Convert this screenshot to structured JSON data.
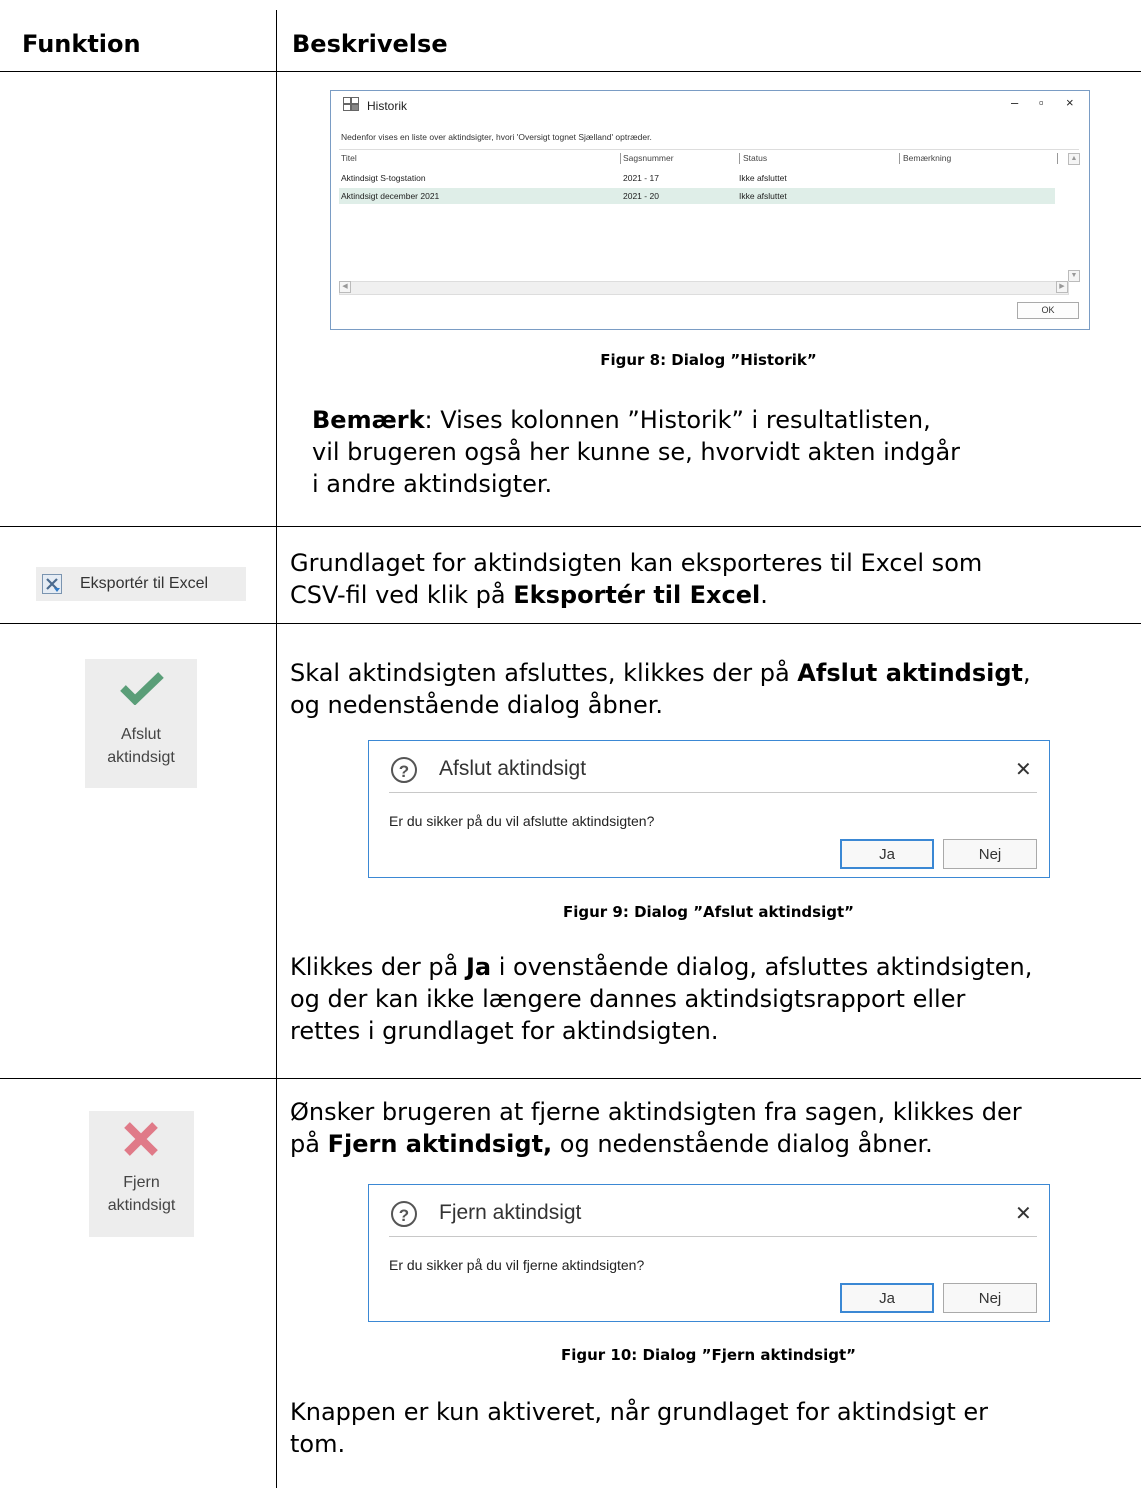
{
  "table": {
    "col_function": "Funktion",
    "col_description": "Beskrivelse"
  },
  "historik": {
    "title": "Historik",
    "description": "Nedenfor vises en liste over aktindsigter, hvori 'Oversigt tognet Sjælland' optræder.",
    "columns": [
      "Titel",
      "Sagsnummer",
      "Status",
      "Bemærkning"
    ],
    "rows": [
      {
        "titel": "Aktindsigt S-togstation",
        "sagsnummer": "2021 - 17",
        "status": "Ikke afsluttet",
        "bemaerkning": "",
        "selected": false
      },
      {
        "titel": "Aktindsigt december 2021",
        "sagsnummer": "2021 - 20",
        "status": "Ikke afsluttet",
        "bemaerkning": "",
        "selected": true
      }
    ],
    "ok_label": "OK",
    "caption": "Figur 8: Dialog ”Historik”",
    "note_bold": "Bemærk",
    "note_line1": ": Vises kolonnen ”Historik” i resultatlisten,",
    "note_line2": "vil brugeren også her kunne se, hvorvidt akten indgår",
    "note_line3": "i andre aktindsigter."
  },
  "export": {
    "button_label": "Eksportér til Excel",
    "text_line1": "Grundlaget for aktindsigten kan eksporteres til Excel som",
    "text_line2_pre": "CSV-fil ved klik på ",
    "text_line2_bold": "Eksportér til Excel",
    "text_line2_post": "."
  },
  "afslut": {
    "button_line1": "Afslut",
    "button_line2": "aktindsigt",
    "intro1_pre": "Skal aktindsigten afsluttes, klikkes der på ",
    "intro1_bold": "Afslut aktindsigt",
    "intro1_post": ",",
    "intro2": "og nedenstående dialog åbner.",
    "dialog_title": "Afslut aktindsigt",
    "dialog_message": "Er du sikker på du vil afslutte aktindsigten?",
    "yes_label": "Ja",
    "no_label": "Nej",
    "caption": "Figur 9: Dialog ”Afslut aktindsigt”",
    "after1_pre": "Klikkes der på ",
    "after1_bold": "Ja",
    "after1_post": "  i ovenstående dialog, afsluttes aktindsigten,",
    "after2": "og der kan ikke længere dannes aktindsigtsrapport eller",
    "after3": "rettes i grundlaget for aktindsigten."
  },
  "fjern": {
    "button_line1": "Fjern",
    "button_line2": "aktindsigt",
    "intro1": "Ønsker brugeren at fjerne aktindsigten fra sagen, klikkes der",
    "intro2_pre": "på ",
    "intro2_bold": "Fjern aktindsigt,",
    "intro2_post": " og nedenstående dialog åbner.",
    "dialog_title": "Fjern aktindsigt",
    "dialog_message": "Er du sikker på du vil fjerne aktindsigten?",
    "yes_label": "Ja",
    "no_label": "Nej",
    "caption": "Figur 10: Dialog ”Fjern aktindsigt”",
    "after1": "Knappen er kun aktiveret, når grundlaget for aktindsigt er",
    "after2": "tom."
  },
  "colors": {
    "check_green": "#5a9e78",
    "cross_red": "#e07a88",
    "dialog_border": "#3b88d4",
    "selected_row": "#dfeee8"
  },
  "icons": [
    "window-icon",
    "minimize-icon",
    "maximize-icon",
    "close-icon",
    "excel-icon",
    "checkmark-icon",
    "cross-icon",
    "question-icon"
  ]
}
